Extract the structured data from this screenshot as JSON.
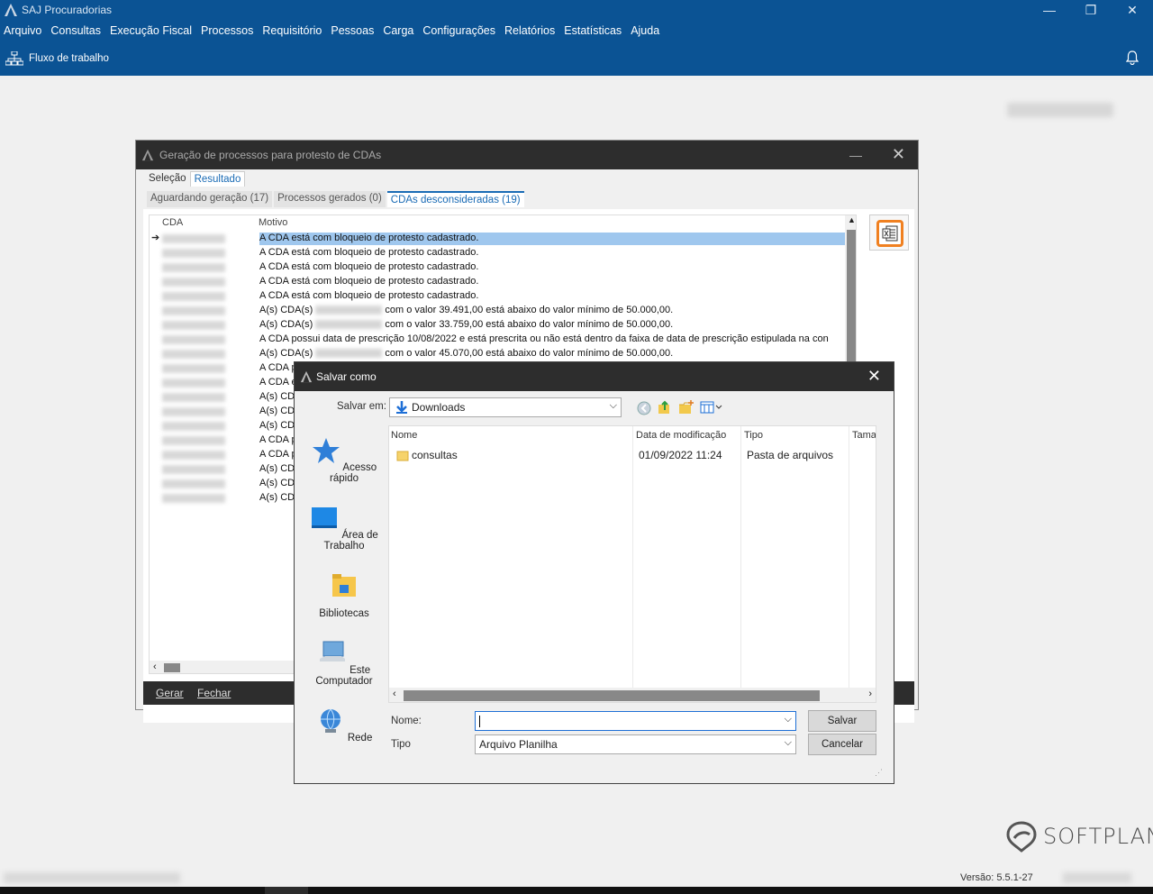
{
  "app": {
    "title": "SAJ Procuradorias",
    "menu": [
      "Arquivo",
      "Consultas",
      "Execução Fiscal",
      "Processos",
      "Requisitório",
      "Pessoas",
      "Carga",
      "Configurações",
      "Relatórios",
      "Estatísticas",
      "Ajuda"
    ],
    "toolbar_label": "Fluxo de trabalho",
    "version": "Versão: 5.5.1-27",
    "brand": "SOFTPLAN",
    "window_controls": {
      "minimize": "—",
      "restore": "❐",
      "close": "✕"
    }
  },
  "protest_dialog": {
    "title": "Geração de processos para protesto de CDAs",
    "tabs": [
      "Seleção",
      "Resultado"
    ],
    "subtabs": [
      "Aguardando geração (17)",
      "Processos gerados (0)",
      "CDAs desconsideradas (19)"
    ],
    "columns": {
      "cda": "CDA",
      "motivo": "Motivo"
    },
    "rows": [
      {
        "motivo": "A CDA está com bloqueio de protesto cadastrado."
      },
      {
        "motivo": "A CDA está com bloqueio de protesto cadastrado."
      },
      {
        "motivo": "A CDA está com bloqueio de protesto cadastrado."
      },
      {
        "motivo": "A CDA está com bloqueio de protesto cadastrado."
      },
      {
        "motivo": "A CDA está com bloqueio de protesto cadastrado."
      },
      {
        "prefix": "A(s) CDA(s)",
        "suffix": "com o valor 39.491,00 está abaixo do valor mínimo de 50.000,00."
      },
      {
        "prefix": "A(s) CDA(s)",
        "suffix": "com o valor 33.759,00 está abaixo do valor mínimo de 50.000,00."
      },
      {
        "motivo": "A CDA possui data de prescrição 10/08/2022 e está prescrita ou não está dentro da faixa de data de prescrição estipulada na con"
      },
      {
        "prefix": "A(s) CDA(s)",
        "suffix": "com o valor 45.070,00 está abaixo do valor mínimo de 50.000,00."
      },
      {
        "motivo": "A CDA p"
      },
      {
        "motivo": "A CDA e"
      },
      {
        "motivo": "A(s) CDA"
      },
      {
        "motivo": "A(s) CDA"
      },
      {
        "motivo": "A(s) CDA"
      },
      {
        "motivo": "A CDA p"
      },
      {
        "motivo": "A CDA p"
      },
      {
        "motivo": "A(s) CDA"
      },
      {
        "motivo": "A(s) CDA"
      },
      {
        "motivo": "A(s) CDA"
      }
    ],
    "footer": {
      "gerar": "Gerar",
      "fechar": "Fechar"
    }
  },
  "save_dialog": {
    "title": "Salvar como",
    "save_in_label": "Salvar em:",
    "save_in_value": "Downloads",
    "places": [
      "Acesso rápido",
      "Área de Trabalho",
      "Bibliotecas",
      "Este Computador",
      "Rede"
    ],
    "columns": {
      "name": "Nome",
      "date": "Data de modificação",
      "type": "Tipo",
      "size": "Tama"
    },
    "files": [
      {
        "name": "consultas",
        "date": "01/09/2022 11:24",
        "type": "Pasta de arquivos"
      }
    ],
    "name_label": "Nome:",
    "name_value": "",
    "type_label": "Tipo",
    "type_value": "Arquivo Planilha",
    "save_button": "Salvar",
    "cancel_button": "Cancelar"
  }
}
